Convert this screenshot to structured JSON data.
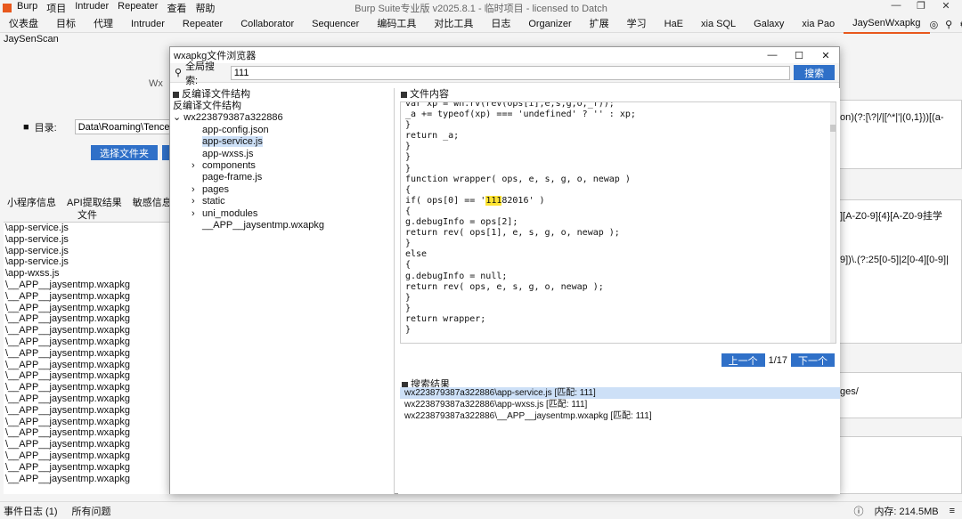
{
  "titlebar": {
    "menus": [
      "Burp",
      "项目",
      "Intruder",
      "Repeater",
      "查看",
      "帮助"
    ],
    "title": "Burp Suite专业版  v2025.8.1 - 临时项目 - licensed to Datch"
  },
  "main_tabs": [
    "仪表盘",
    "目标",
    "代理",
    "Intruder",
    "Repeater",
    "Collaborator",
    "Sequencer",
    "编码工具",
    "对比工具",
    "日志",
    "Organizer",
    "扩展",
    "学习",
    "HaE",
    "xia SQL",
    "Galaxy",
    "xia Pao",
    "JaySenWxapkg"
  ],
  "active_main_tab": "JaySenWxapkg",
  "sub_tab": "JaySenScan",
  "background": {
    "wx_label": "Wx",
    "dir_label": "目录:",
    "dir_value": "Data\\Roaming\\Tencen",
    "choose_folder": "选择文件夹",
    "tabs": [
      "小程序信息",
      "API提取结果",
      "敏感信息"
    ],
    "table_header": "文件",
    "rows": [
      "\\app-service.js",
      "\\app-service.js",
      "\\app-service.js",
      "\\app-service.js",
      "\\app-wxss.js",
      "\\__APP__jaysentmp.wxapkg",
      "\\__APP__jaysentmp.wxapkg",
      "\\__APP__jaysentmp.wxapkg",
      "\\__APP__jaysentmp.wxapkg",
      "\\__APP__jaysentmp.wxapkg",
      "\\__APP__jaysentmp.wxapkg",
      "\\__APP__jaysentmp.wxapkg",
      "\\__APP__jaysentmp.wxapkg",
      "\\__APP__jaysentmp.wxapkg",
      "\\__APP__jaysentmp.wxapkg",
      "\\__APP__jaysentmp.wxapkg",
      "\\__APP__jaysentmp.wxapkg",
      "\\__APP__jaysentmp.wxapkg",
      "\\__APP__jaysentmp.wxapkg",
      "\\__APP__jaysentmp.wxapkg",
      "\\__APP__jaysentmp.wxapkg",
      "\\__APP__jaysentmp.wxapkg",
      "\\__APP__jaysentmp.wxapkg"
    ],
    "right_text_1": "on)(?:[\\?|/|[^*|'|(0,1}))[(a-",
    "right_text_2": "][A-Z0-9]{4}[A-Z0-9挂学",
    "right_text_3": "9])\\.(?:25[0-5]|2[0-4][0-9]|",
    "right_text_4": "ges/"
  },
  "dialog": {
    "title": "wxapkg文件浏览器",
    "search_label": "全局搜索:",
    "search_value": "111",
    "search_button": "搜索",
    "tree_header": "反编译文件结构",
    "tree_root_label": "反编译文件结构",
    "tree_package": "wx223879387a322886",
    "tree_items": [
      {
        "label": "app-config.json",
        "arrow": ""
      },
      {
        "label": "app-service.js",
        "arrow": "",
        "selected": true
      },
      {
        "label": "app-wxss.js",
        "arrow": ""
      },
      {
        "label": "components",
        "arrow": "›"
      },
      {
        "label": "page-frame.js",
        "arrow": ""
      },
      {
        "label": "pages",
        "arrow": "›"
      },
      {
        "label": "static",
        "arrow": "›"
      },
      {
        "label": "uni_modules",
        "arrow": "›"
      },
      {
        "label": "__APP__jaysentmp.wxapkg",
        "arrow": ""
      }
    ],
    "content_header": "文件内容",
    "code_lines_before": "var xp = wh.rv(rev(ops[i],e,s,g,o,_f));\n_a += typeof(xp) === 'undefined' ? '' : xp;\n}\nreturn _a;\n}\n}\n}\nfunction wrapper( ops, e, s, g, o, newap )\n{\nif( ops[0] == '",
    "code_highlight": "111",
    "code_lines_after": "82016' )\n{\ng.debugInfo = ops[2];\nreturn rev( ops[1], e, s, g, o, newap );\n}\nelse\n{\ng.debugInfo = null;\nreturn rev( ops, e, s, g, o, newap );\n}\n}\nreturn wrapper;\n}",
    "prev_button": "上一个",
    "counter": "1/17",
    "next_button": "下一个",
    "results_header": "搜索结果",
    "results": [
      "wx223879387a322886\\app-service.js [匹配: 111]",
      "wx223879387a322886\\app-wxss.js [匹配: 111]",
      "wx223879387a322886\\__APP__jaysentmp.wxapkg [匹配: 111]"
    ]
  },
  "statusbar": {
    "event_log": "事件日志 (1)",
    "all_issues": "所有问题",
    "memory": "内存: 214.5MB"
  },
  "colors": {
    "accent": "#e8581d",
    "button_blue": "#2f70c8",
    "selection": "#cde0f7",
    "highlight": "#ffe433"
  }
}
